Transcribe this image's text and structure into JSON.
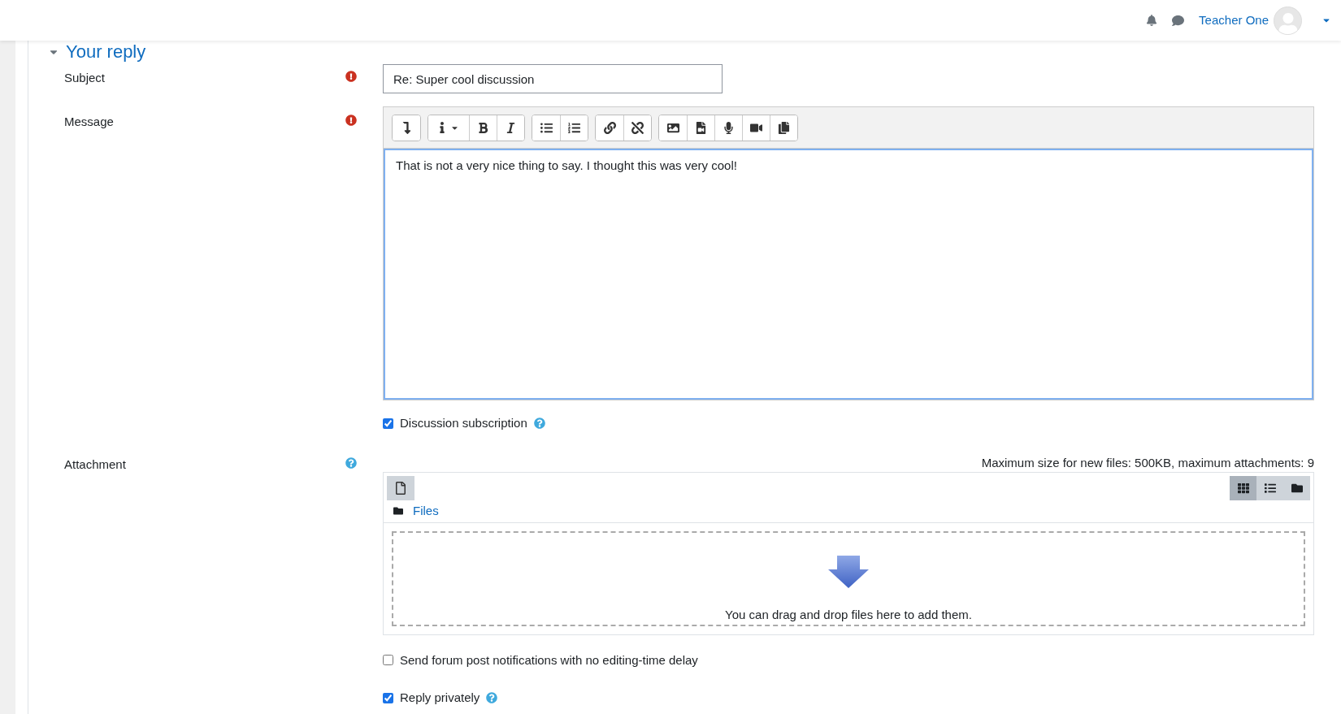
{
  "header": {
    "user_name": "Teacher One"
  },
  "section": {
    "title": "Your reply",
    "expanded": true
  },
  "subject": {
    "label": "Subject",
    "required": true,
    "value": "Re: Super cool discussion"
  },
  "message": {
    "label": "Message",
    "required": true,
    "value": "That is not a very nice thing to say. I thought this was very cool!"
  },
  "discussion_subscription": {
    "label": "Discussion subscription",
    "checked": true,
    "help": true
  },
  "attachment": {
    "label": "Attachment",
    "help": true,
    "limits": "Maximum size for new files: 500KB, maximum attachments: 9",
    "path": "Files",
    "dropzone_text": "You can drag and drop files here to add them.",
    "views": [
      {
        "kind": "grid",
        "selected": true
      },
      {
        "kind": "list",
        "selected": false
      },
      {
        "kind": "tree",
        "selected": false
      }
    ]
  },
  "options": [
    {
      "label": "Send forum post notifications with no editing-time delay",
      "checked": false,
      "help": false
    },
    {
      "label": "Reply privately",
      "checked": true,
      "help": true
    }
  ]
}
